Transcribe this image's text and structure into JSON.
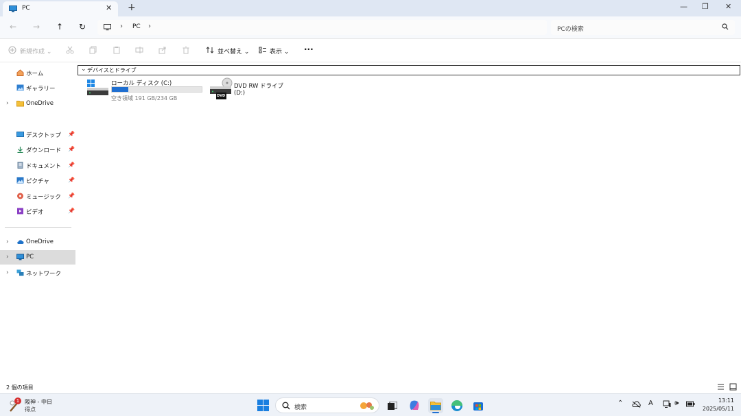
{
  "window": {
    "tab_title": "PC",
    "tab_close": "✕",
    "new_tab": "+",
    "minimize": "—",
    "maximize": "❐",
    "close": "✕"
  },
  "nav": {
    "back": "←",
    "forward": "→",
    "up": "↑",
    "refresh": "↻",
    "breadcrumb_sep": "›",
    "breadcrumb": [
      "PC"
    ]
  },
  "search": {
    "placeholder": "PCの検索"
  },
  "toolbar": {
    "new_label": "新規作成",
    "sort_label": "並べ替え",
    "view_label": "表示",
    "more": "···"
  },
  "sidebar": {
    "items": [
      {
        "label": "ホーム",
        "icon": "home-icon"
      },
      {
        "label": "ギャラリー",
        "icon": "gallery-icon"
      },
      {
        "label": "OneDrive",
        "icon": "folder-icon"
      },
      {
        "label": "デスクトップ",
        "icon": "desktop-icon",
        "pinned": true
      },
      {
        "label": "ダウンロード",
        "icon": "download-icon",
        "pinned": true
      },
      {
        "label": "ドキュメント",
        "icon": "document-icon",
        "pinned": true
      },
      {
        "label": "ピクチャ",
        "icon": "pictures-icon",
        "pinned": true
      },
      {
        "label": "ミュージック",
        "icon": "music-icon",
        "pinned": true
      },
      {
        "label": "ビデオ",
        "icon": "video-icon",
        "pinned": true
      },
      {
        "label": "OneDrive",
        "icon": "cloud-icon"
      },
      {
        "label": "PC",
        "icon": "pc-icon",
        "selected": true
      },
      {
        "label": "ネットワーク",
        "icon": "network-icon"
      }
    ]
  },
  "content": {
    "group_label": "デバイスとドライブ",
    "drives": [
      {
        "name": "ローカル ディスク (C:)",
        "free_text": "空き領域 191 GB/234 GB",
        "used_fraction": 0.18
      },
      {
        "name": "DVD RW ドライブ (D:)",
        "badge": "DVD"
      }
    ]
  },
  "status": {
    "item_count": "2 個の項目"
  },
  "taskbar": {
    "weather_line1": "阪神 - 中日",
    "weather_line2": "得点",
    "weather_badge": "1",
    "search_placeholder": "検索",
    "time": "13:11",
    "date": "2025/05/11"
  },
  "colors": {
    "accent": "#1f6fd1",
    "titlebar": "#dfe7f3",
    "selection": "#dcdcdc"
  }
}
